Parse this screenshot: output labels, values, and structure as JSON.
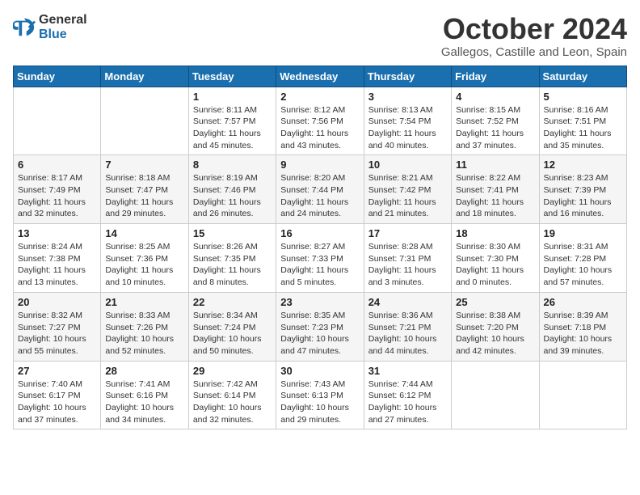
{
  "header": {
    "logo_general": "General",
    "logo_blue": "Blue",
    "month_title": "October 2024",
    "location": "Gallegos, Castille and Leon, Spain"
  },
  "days_of_week": [
    "Sunday",
    "Monday",
    "Tuesday",
    "Wednesday",
    "Thursday",
    "Friday",
    "Saturday"
  ],
  "weeks": [
    [
      {
        "day": "",
        "content": ""
      },
      {
        "day": "",
        "content": ""
      },
      {
        "day": "1",
        "content": "Sunrise: 8:11 AM\nSunset: 7:57 PM\nDaylight: 11 hours and 45 minutes."
      },
      {
        "day": "2",
        "content": "Sunrise: 8:12 AM\nSunset: 7:56 PM\nDaylight: 11 hours and 43 minutes."
      },
      {
        "day": "3",
        "content": "Sunrise: 8:13 AM\nSunset: 7:54 PM\nDaylight: 11 hours and 40 minutes."
      },
      {
        "day": "4",
        "content": "Sunrise: 8:15 AM\nSunset: 7:52 PM\nDaylight: 11 hours and 37 minutes."
      },
      {
        "day": "5",
        "content": "Sunrise: 8:16 AM\nSunset: 7:51 PM\nDaylight: 11 hours and 35 minutes."
      }
    ],
    [
      {
        "day": "6",
        "content": "Sunrise: 8:17 AM\nSunset: 7:49 PM\nDaylight: 11 hours and 32 minutes."
      },
      {
        "day": "7",
        "content": "Sunrise: 8:18 AM\nSunset: 7:47 PM\nDaylight: 11 hours and 29 minutes."
      },
      {
        "day": "8",
        "content": "Sunrise: 8:19 AM\nSunset: 7:46 PM\nDaylight: 11 hours and 26 minutes."
      },
      {
        "day": "9",
        "content": "Sunrise: 8:20 AM\nSunset: 7:44 PM\nDaylight: 11 hours and 24 minutes."
      },
      {
        "day": "10",
        "content": "Sunrise: 8:21 AM\nSunset: 7:42 PM\nDaylight: 11 hours and 21 minutes."
      },
      {
        "day": "11",
        "content": "Sunrise: 8:22 AM\nSunset: 7:41 PM\nDaylight: 11 hours and 18 minutes."
      },
      {
        "day": "12",
        "content": "Sunrise: 8:23 AM\nSunset: 7:39 PM\nDaylight: 11 hours and 16 minutes."
      }
    ],
    [
      {
        "day": "13",
        "content": "Sunrise: 8:24 AM\nSunset: 7:38 PM\nDaylight: 11 hours and 13 minutes."
      },
      {
        "day": "14",
        "content": "Sunrise: 8:25 AM\nSunset: 7:36 PM\nDaylight: 11 hours and 10 minutes."
      },
      {
        "day": "15",
        "content": "Sunrise: 8:26 AM\nSunset: 7:35 PM\nDaylight: 11 hours and 8 minutes."
      },
      {
        "day": "16",
        "content": "Sunrise: 8:27 AM\nSunset: 7:33 PM\nDaylight: 11 hours and 5 minutes."
      },
      {
        "day": "17",
        "content": "Sunrise: 8:28 AM\nSunset: 7:31 PM\nDaylight: 11 hours and 3 minutes."
      },
      {
        "day": "18",
        "content": "Sunrise: 8:30 AM\nSunset: 7:30 PM\nDaylight: 11 hours and 0 minutes."
      },
      {
        "day": "19",
        "content": "Sunrise: 8:31 AM\nSunset: 7:28 PM\nDaylight: 10 hours and 57 minutes."
      }
    ],
    [
      {
        "day": "20",
        "content": "Sunrise: 8:32 AM\nSunset: 7:27 PM\nDaylight: 10 hours and 55 minutes."
      },
      {
        "day": "21",
        "content": "Sunrise: 8:33 AM\nSunset: 7:26 PM\nDaylight: 10 hours and 52 minutes."
      },
      {
        "day": "22",
        "content": "Sunrise: 8:34 AM\nSunset: 7:24 PM\nDaylight: 10 hours and 50 minutes."
      },
      {
        "day": "23",
        "content": "Sunrise: 8:35 AM\nSunset: 7:23 PM\nDaylight: 10 hours and 47 minutes."
      },
      {
        "day": "24",
        "content": "Sunrise: 8:36 AM\nSunset: 7:21 PM\nDaylight: 10 hours and 44 minutes."
      },
      {
        "day": "25",
        "content": "Sunrise: 8:38 AM\nSunset: 7:20 PM\nDaylight: 10 hours and 42 minutes."
      },
      {
        "day": "26",
        "content": "Sunrise: 8:39 AM\nSunset: 7:18 PM\nDaylight: 10 hours and 39 minutes."
      }
    ],
    [
      {
        "day": "27",
        "content": "Sunrise: 7:40 AM\nSunset: 6:17 PM\nDaylight: 10 hours and 37 minutes."
      },
      {
        "day": "28",
        "content": "Sunrise: 7:41 AM\nSunset: 6:16 PM\nDaylight: 10 hours and 34 minutes."
      },
      {
        "day": "29",
        "content": "Sunrise: 7:42 AM\nSunset: 6:14 PM\nDaylight: 10 hours and 32 minutes."
      },
      {
        "day": "30",
        "content": "Sunrise: 7:43 AM\nSunset: 6:13 PM\nDaylight: 10 hours and 29 minutes."
      },
      {
        "day": "31",
        "content": "Sunrise: 7:44 AM\nSunset: 6:12 PM\nDaylight: 10 hours and 27 minutes."
      },
      {
        "day": "",
        "content": ""
      },
      {
        "day": "",
        "content": ""
      }
    ]
  ]
}
